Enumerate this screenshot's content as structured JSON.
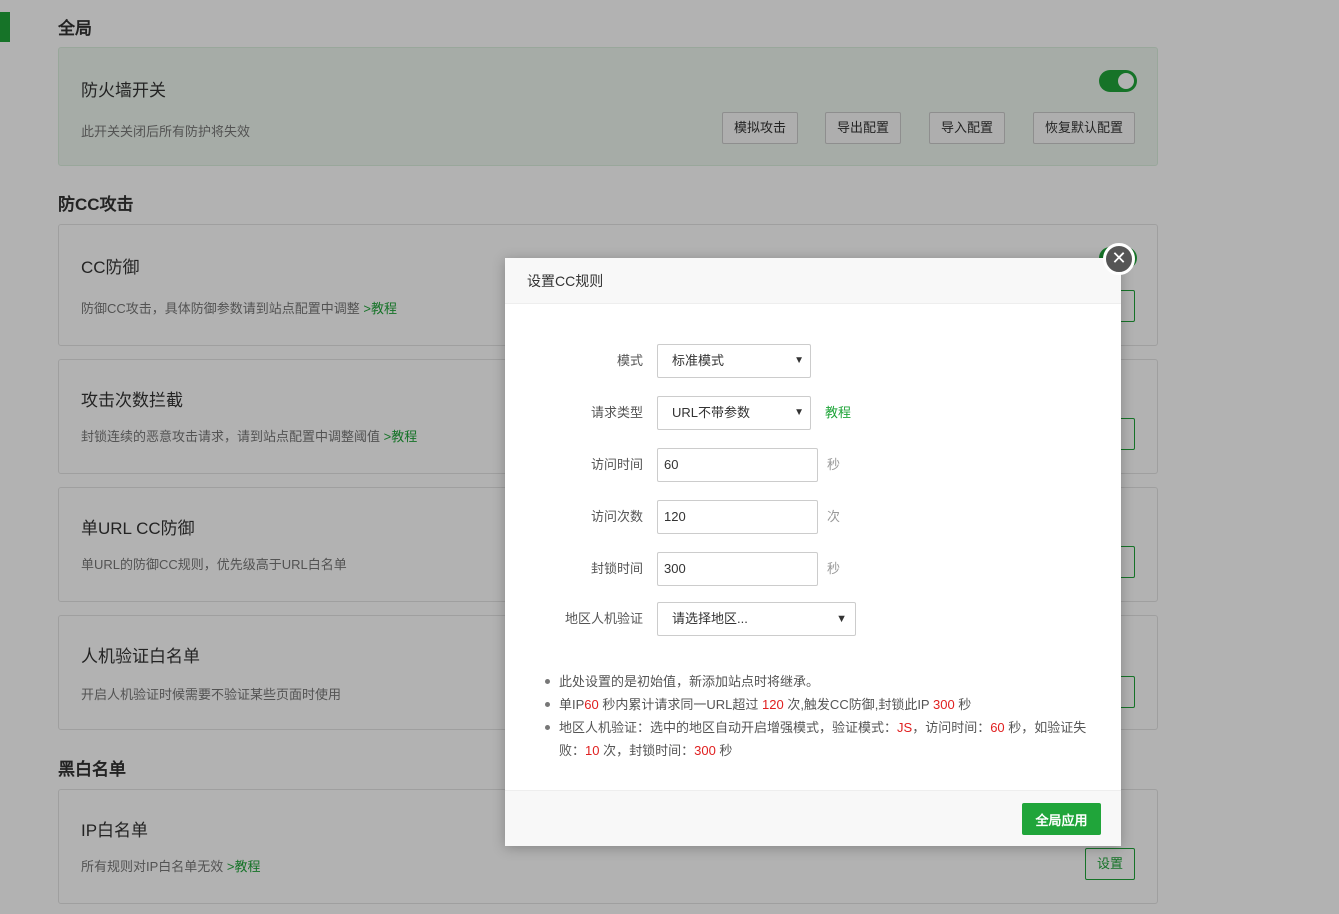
{
  "sections": {
    "global": "全局",
    "anti_cc": "防CC攻击",
    "black_white": "黑白名单"
  },
  "global_card": {
    "title": "防火墙开关",
    "desc": "此开关关闭后所有防护将失效",
    "toggle_on": true,
    "buttons": [
      "模拟攻击",
      "导出配置",
      "导入配置",
      "恢复默认配置"
    ]
  },
  "cards": {
    "cc": {
      "title": "CC防御",
      "desc": "防御CC攻击，具体防御参数请到站点配置中调整 ",
      "link": ">教程"
    },
    "attack_count": {
      "title": "攻击次数拦截",
      "desc": "封锁连续的恶意攻击请求，请到站点配置中调整阈值 ",
      "link": ">教程"
    },
    "single_url": {
      "title": "单URL CC防御",
      "desc": "单URL的防御CC规则，优先级高于URL白名单"
    },
    "captcha_whitelist": {
      "title": "人机验证白名单",
      "desc": "开启人机验证时候需要不验证某些页面时使用"
    },
    "ip_whitelist": {
      "title": "IP白名单",
      "desc": "所有规则对IP白名单无效 ",
      "link": ">教程",
      "button": "设置"
    }
  },
  "dialog": {
    "title": "设置CC规则",
    "close": "✕",
    "fields": {
      "mode": {
        "label": "模式",
        "value": "标准模式"
      },
      "request_type": {
        "label": "请求类型",
        "value": "URL不带参数",
        "link": "教程"
      },
      "visit_time": {
        "label": "访问时间",
        "value": "60",
        "unit": "秒"
      },
      "visit_count": {
        "label": "访问次数",
        "value": "120",
        "unit": "次"
      },
      "block_time": {
        "label": "封锁时间",
        "value": "300",
        "unit": "秒"
      },
      "region": {
        "label": "地区人机验证",
        "placeholder": "请选择地区..."
      }
    },
    "notes": {
      "n1": "此处设置的是初始值，新添加站点时将继承。",
      "n2": {
        "a": "单IP",
        "b": "60",
        "c": " 秒内累计请求同一URL超过 ",
        "d": "120",
        "e": " 次,触发CC防御,封锁此IP ",
        "f": "300",
        "g": " 秒"
      },
      "n3": {
        "a": "地区人机验证：选中的地区自动开启增强模式，验证模式：",
        "b": "JS",
        "c": "，访问时间：",
        "d": "60",
        "e": " 秒，如验证失败：",
        "f": "10",
        "g": " 次，封锁时间：",
        "h": "300",
        "i": " 秒"
      }
    },
    "apply": "全局应用"
  },
  "colors": {
    "accent": "#20a53a",
    "highlight": "#e02020"
  }
}
